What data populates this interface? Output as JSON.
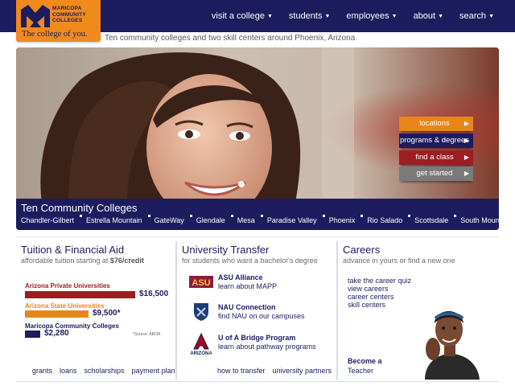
{
  "logo": {
    "name": "MARICOPA\nCOMMUNITY\nCOLLEGES",
    "tagline": "The college of you."
  },
  "nav": [
    {
      "label": "visit a college"
    },
    {
      "label": "students"
    },
    {
      "label": "employees"
    },
    {
      "label": "about"
    },
    {
      "label": "search"
    }
  ],
  "site_tagline": "Ten community colleges and two skill centers around Phoenix, Arizona",
  "hero": {
    "buttons": [
      {
        "label": "locations",
        "color": "#e8861a"
      },
      {
        "label": "programs & degrees",
        "color": "#1c1c5e"
      },
      {
        "label": "find a class",
        "color": "#9c1d22"
      },
      {
        "label": "get started",
        "color": "#7a7a7a"
      }
    ],
    "band_title": "Ten Community Colleges",
    "colleges": [
      "Chandler-Gilbert",
      "Estrella Mountain",
      "GateWay",
      "Glendale",
      "Mesa",
      "Paradise Valley",
      "Phoenix",
      "Rio Salado",
      "Scottsdale",
      "South Mountain"
    ]
  },
  "tuition": {
    "title": "Tuition & Financial Aid",
    "subtitle_prefix": "affordable tuition starting at ",
    "subtitle_amount": "$76/credit",
    "source": "*Source: ABOR",
    "links": [
      "grants",
      "loans",
      "scholarships",
      "payment plan"
    ]
  },
  "chart_data": {
    "type": "bar",
    "categories": [
      "Arizona Private Universities",
      "Arizona State Universities",
      "Maricopa Community Colleges"
    ],
    "values": [
      16500,
      9500,
      2280
    ],
    "value_labels": [
      "$16,500",
      "$9,500*",
      "$2,280"
    ],
    "colors": [
      "#9c1d22",
      "#e8861a",
      "#1c1c5e"
    ]
  },
  "transfer": {
    "title": "University Transfer",
    "subtitle": "for students who want a bachelor's degree",
    "items": [
      {
        "icon": "asu-logo-icon",
        "title": "ASU Alliance",
        "desc": "learn about MAPP"
      },
      {
        "icon": "nau-logo-icon",
        "title": "NAU Connection",
        "desc": "find NAU on our campuses"
      },
      {
        "icon": "arizona-logo-icon",
        "title": "U of A Bridge Program",
        "desc": "learn about pathway programs"
      }
    ],
    "links": [
      "how to transfer",
      "university partners"
    ]
  },
  "careers": {
    "title": "Careers",
    "subtitle": "advance in yours or find a new one",
    "links": [
      "take the career quiz",
      "view careers",
      "career centers",
      "skill centers"
    ],
    "become_title": "Become a",
    "become_role": "Teacher"
  }
}
